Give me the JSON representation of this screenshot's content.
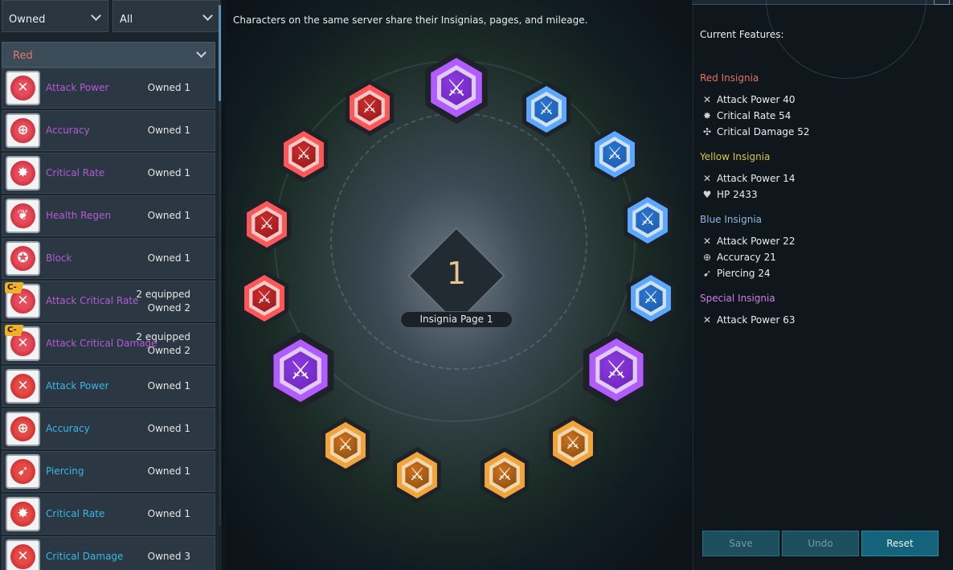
{
  "filters": {
    "owned_dropdown": "Owned",
    "all_dropdown": "All"
  },
  "group": {
    "label": "Red"
  },
  "list": [
    {
      "name": "Attack Power",
      "count": "Owned 1",
      "color": "purple",
      "glyph": "✕"
    },
    {
      "name": "Accuracy",
      "count": "Owned 1",
      "color": "purple",
      "glyph": "⊕"
    },
    {
      "name": "Critical Rate",
      "count": "Owned 1",
      "color": "purple",
      "glyph": "✸"
    },
    {
      "name": "Health Regen",
      "count": "Owned 1",
      "color": "purple",
      "glyph": "❦"
    },
    {
      "name": "Block",
      "count": "Owned 1",
      "color": "purple",
      "glyph": "✪"
    },
    {
      "name": "Attack Critical Rate",
      "equipped": "2 equipped",
      "count": "Owned 2",
      "color": "purple",
      "glyph": "✕",
      "badge": "C-"
    },
    {
      "name": "Attack Critical Damage",
      "equipped": "2 equipped",
      "count": "Owned 2",
      "color": "purple",
      "glyph": "✕",
      "badge": "C-"
    },
    {
      "name": "Attack Power",
      "count": "Owned 1",
      "color": "blue",
      "glyph": "✕"
    },
    {
      "name": "Accuracy",
      "count": "Owned 1",
      "color": "blue",
      "glyph": "⊕"
    },
    {
      "name": "Piercing",
      "count": "Owned 1",
      "color": "blue",
      "glyph": "➹"
    },
    {
      "name": "Critical Rate",
      "count": "Owned 1",
      "color": "blue",
      "glyph": "✸"
    },
    {
      "name": "Critical Damage",
      "count": "Owned 3",
      "color": "blue",
      "glyph": "✕"
    }
  ],
  "main": {
    "info": "Characters on the same server share their Insignias, pages, and mileage.",
    "page_number": "1",
    "page_label": "Insignia Page 1"
  },
  "slots": [
    {
      "tier": "special",
      "glyph": "⚔"
    },
    {
      "tier": "blue",
      "glyph": "⚔"
    },
    {
      "tier": "blue",
      "glyph": "⚔"
    },
    {
      "tier": "blue",
      "glyph": "⚔"
    },
    {
      "tier": "blue",
      "glyph": "⚔"
    },
    {
      "tier": "special",
      "glyph": "⚔"
    },
    {
      "tier": "yellow",
      "glyph": "⚔"
    },
    {
      "tier": "yellow",
      "glyph": "⚔"
    },
    {
      "tier": "yellow",
      "glyph": "⚔"
    },
    {
      "tier": "yellow",
      "glyph": "⚔"
    },
    {
      "tier": "special",
      "glyph": "⚔"
    },
    {
      "tier": "red",
      "glyph": "⚔"
    },
    {
      "tier": "red",
      "glyph": "⚔"
    },
    {
      "tier": "red",
      "glyph": "⚔"
    },
    {
      "tier": "red",
      "glyph": "⚔"
    }
  ],
  "features": {
    "title": "Current Features:",
    "sections": [
      {
        "label": "Red Insignia",
        "color": "#e0735f",
        "items": [
          {
            "icon": "✕",
            "text": "Attack Power 40"
          },
          {
            "icon": "✸",
            "text": "Critical Rate 54"
          },
          {
            "icon": "✣",
            "text": "Critical Damage 52"
          }
        ]
      },
      {
        "label": "Yellow Insignia",
        "color": "#d8c64a",
        "items": [
          {
            "icon": "✕",
            "text": "Attack Power 14"
          },
          {
            "icon": "♥",
            "text": "HP 2433"
          }
        ]
      },
      {
        "label": "Blue Insignia",
        "color": "#8fb8e0",
        "items": [
          {
            "icon": "✕",
            "text": "Attack Power 22"
          },
          {
            "icon": "⊕",
            "text": "Accuracy 21"
          },
          {
            "icon": "➹",
            "text": "Piercing 24"
          }
        ]
      },
      {
        "label": "Special Insignia",
        "color": "#cf7ee6",
        "items": [
          {
            "icon": "✕",
            "text": "Attack Power 63"
          }
        ]
      }
    ]
  },
  "buttons": {
    "save": "Save",
    "undo": "Undo",
    "reset": "Reset"
  }
}
